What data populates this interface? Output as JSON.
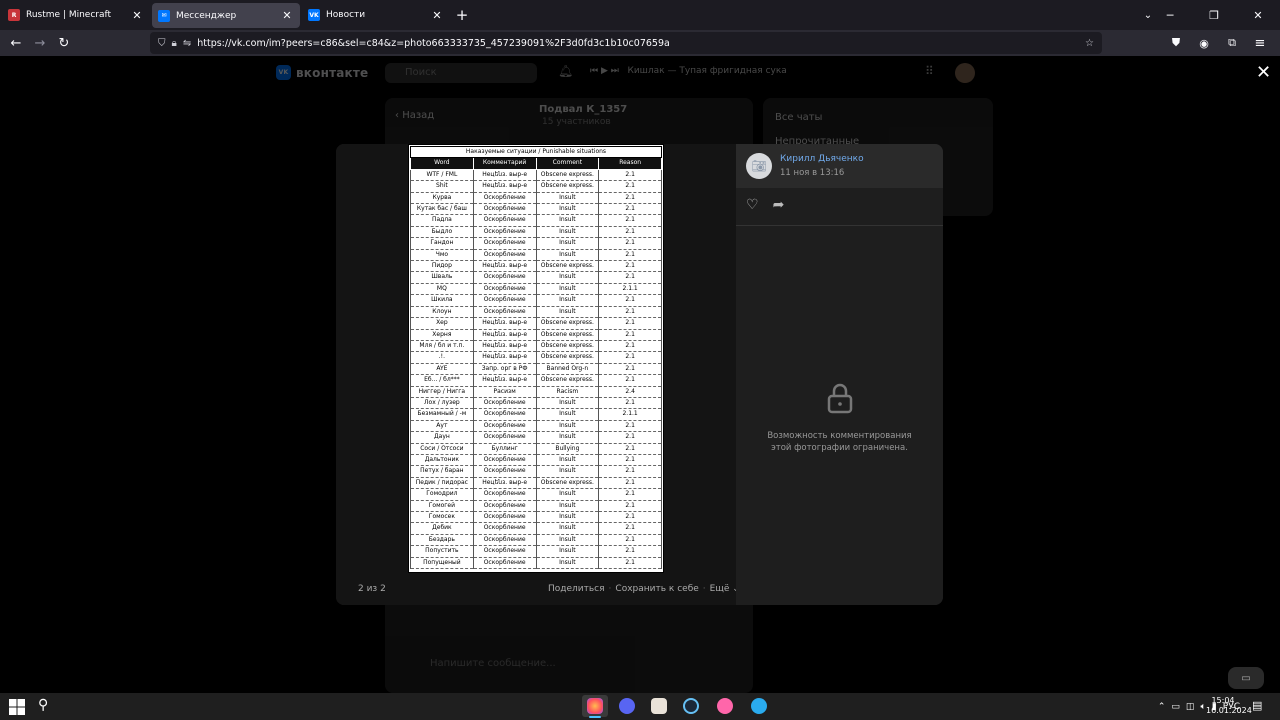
{
  "browser": {
    "tabs": [
      {
        "label": "Rustme | Minecraft",
        "favicon_color": "#c8353a",
        "favicon_text": "R"
      },
      {
        "label": "Мессенджер",
        "favicon_color": "#0077ff",
        "favicon_text": "✉"
      },
      {
        "label": "Новости",
        "favicon_color": "#0077ff",
        "favicon_text": "VK"
      }
    ],
    "url": "https://vk.com/im?peers=c86&sel=c84&z=photo663333735_457239091%2F3d0fd3c1b10c07659a",
    "url_host": "vk.com",
    "new_tab": "+",
    "list_tabs": "⌄"
  },
  "vk_background": {
    "logo": "вконтакте",
    "search_placeholder": "Поиск",
    "player_text": "Кишлак — Тупая фригидная сука",
    "chat_title": "Подвал К_1357",
    "chat_subtitle": "15 участников",
    "back_label": "Назад",
    "right_panel_items": [
      "Все чаты",
      "Непрочитанные"
    ],
    "message_placeholder": "Напишите сообщение..."
  },
  "photo": {
    "table_title": "Наказуемые ситуации / Punishable situations",
    "columns": [
      "Word",
      "Комментарий",
      "Comment",
      "Reason"
    ],
    "rows": [
      [
        "WTF / FML",
        "Нецենз. выр-е",
        "Obscene express.",
        "2.1"
      ],
      [
        "Shit",
        "Нецենз. выр-е",
        "Obscene express.",
        "2.1"
      ],
      [
        "Курва",
        "Оскорбление",
        "Insult",
        "2.1"
      ],
      [
        "Кутак бас / баш",
        "Оскорбление",
        "Insult",
        "2.1"
      ],
      [
        "Падла",
        "Оскорбление",
        "Insult",
        "2.1"
      ],
      [
        "Быдло",
        "Оскорбление",
        "Insult",
        "2.1"
      ],
      [
        "Гандон",
        "Оскорбление",
        "Insult",
        "2.1"
      ],
      [
        "Чмо",
        "Оскорбление",
        "Insult",
        "2.1"
      ],
      [
        "Пидор",
        "Нецենз. выр-е",
        "Obscene express.",
        "2.1"
      ],
      [
        "Шваль",
        "Оскорбление",
        "Insult",
        "2.1"
      ],
      [
        "MQ",
        "Оскорбление",
        "Insult",
        "2.1.1"
      ],
      [
        "Шкила",
        "Оскорбление",
        "Insult",
        "2.1"
      ],
      [
        "Клоун",
        "Оскорбление",
        "Insult",
        "2.1"
      ],
      [
        "Хер",
        "Нецենз. выр-е",
        "Obscene express.",
        "2.1"
      ],
      [
        "Херня",
        "Нецենз. выр-е",
        "Obscene express.",
        "2.1"
      ],
      [
        "Мля / бл и т.п.",
        "Нецենз. выр-е",
        "Obscene express.",
        "2.1"
      ],
      [
        ".!.",
        "Нецենз. выр-е",
        "Obscene express.",
        "2.1"
      ],
      [
        "AYE",
        "Запр. орг в РФ",
        "Banned Org-n",
        "2.1"
      ],
      [
        "Еб... / бл***",
        "Нецենз. выр-е",
        "Obscene express.",
        "2.1"
      ],
      [
        "Ниггер / Нигга",
        "Расизм",
        "Racism",
        "2.4"
      ],
      [
        "Лох / лузер",
        "Оскорбление",
        "Insult",
        "2.1"
      ],
      [
        "Безмамный / -м",
        "Оскорбление",
        "Insult",
        "2.1.1"
      ],
      [
        "Аут",
        "Оскорбление",
        "Insult",
        "2.1"
      ],
      [
        "Даун",
        "Оскорбление",
        "Insult",
        "2.1"
      ],
      [
        "Соси / Отсоси",
        "Буллинг",
        "Bullying",
        "2.1"
      ],
      [
        "Дальтоник",
        "Оскорбление",
        "Insult",
        "2.1"
      ],
      [
        "Петух / баран",
        "Оскорбление",
        "Insult",
        "2.1"
      ],
      [
        "Педик / пидорас",
        "Нецենз. выр-е",
        "Obscene express.",
        "2.1"
      ],
      [
        "Гомодрил",
        "Оскорбление",
        "Insult",
        "2.1"
      ],
      [
        "Гомогей",
        "Оскорбление",
        "Insult",
        "2.1"
      ],
      [
        "Гомосек",
        "Оскорбление",
        "Insult",
        "2.1"
      ],
      [
        "Дебик",
        "Оскорбление",
        "Insult",
        "2.1"
      ],
      [
        "Бездарь",
        "Оскорбление",
        "Insult",
        "2.1"
      ],
      [
        "Попустить",
        "Оскорбление",
        "Insult",
        "2.1"
      ],
      [
        "Попущеный",
        "Оскорбление",
        "Insult",
        "2.1"
      ]
    ],
    "counter": "2 из 2",
    "share_label": "Поделиться",
    "save_label": "Сохранить к себе",
    "more_label": "Ещё"
  },
  "sidebar": {
    "author_name": "Кирилл Дьяченко",
    "date": "11 ноя в 13:16",
    "restricted_text": "Возможность комментирования этой фотографии ограничена."
  },
  "taskbar": {
    "language": "РУС",
    "time": "15:04",
    "date": "16.01.2024"
  }
}
